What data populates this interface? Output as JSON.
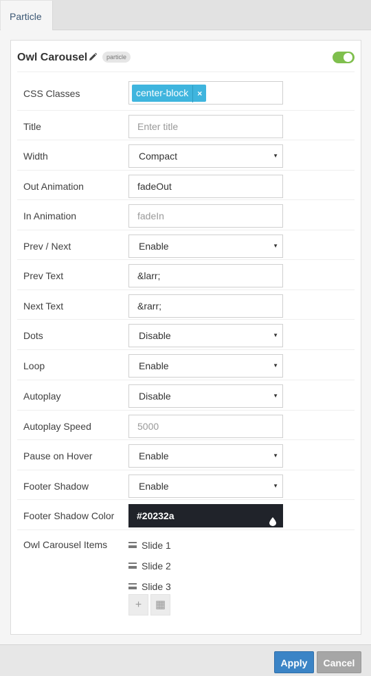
{
  "tab": {
    "label": "Particle"
  },
  "particle": {
    "title": "Owl Carousel",
    "badge": "particle",
    "enabled": true
  },
  "fields": [
    {
      "label": "CSS Classes",
      "type": "tags",
      "tags": [
        {
          "text": "center-block",
          "remove": "×"
        }
      ]
    },
    {
      "label": "Title",
      "type": "text",
      "value": "",
      "placeholder": "Enter title"
    },
    {
      "label": "Width",
      "type": "select",
      "value": "Compact"
    },
    {
      "label": "Out Animation",
      "type": "text",
      "value": "fadeOut",
      "placeholder": ""
    },
    {
      "label": "In Animation",
      "type": "text",
      "value": "",
      "placeholder": "fadeIn"
    },
    {
      "label": "Prev / Next",
      "type": "select",
      "value": "Enable"
    },
    {
      "label": "Prev Text",
      "type": "text",
      "value": "&larr;",
      "placeholder": ""
    },
    {
      "label": "Next Text",
      "type": "text",
      "value": "&rarr;",
      "placeholder": ""
    },
    {
      "label": "Dots",
      "type": "select",
      "value": "Disable"
    },
    {
      "label": "Loop",
      "type": "select",
      "value": "Enable"
    },
    {
      "label": "Autoplay",
      "type": "select",
      "value": "Disable"
    },
    {
      "label": "Autoplay Speed",
      "type": "text",
      "value": "",
      "placeholder": "5000"
    },
    {
      "label": "Pause on Hover",
      "type": "select",
      "value": "Enable"
    },
    {
      "label": "Footer Shadow",
      "type": "select",
      "value": "Enable"
    },
    {
      "label": "Footer Shadow Color",
      "type": "color",
      "value": "#20232a"
    }
  ],
  "items": {
    "label": "Owl Carousel Items",
    "list": [
      "Slide 1",
      "Slide 2",
      "Slide 3"
    ],
    "add_symbol": "+",
    "grid_symbol": "▦"
  },
  "select_caret": "▼",
  "footer": {
    "apply_label": "Apply",
    "cancel_label": "Cancel"
  },
  "colors": {
    "accent": "#3b84c6",
    "tag": "#3fb5de",
    "toggle": "#7fbf4d",
    "swatch": "#20232a"
  }
}
